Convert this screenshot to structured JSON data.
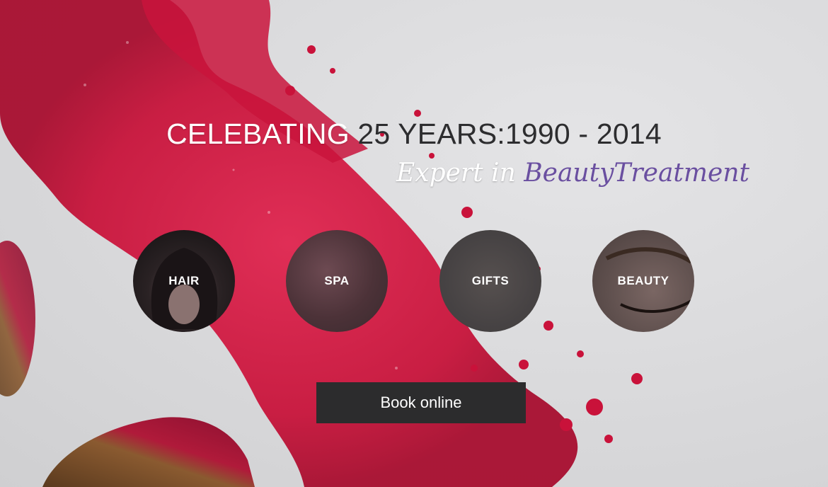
{
  "hero": {
    "headline_light": "CELEBATING",
    "headline_dark": "25 YEARS:1990 - 2014",
    "tagline_white": "Expert in",
    "tagline_purple": "BeautyTreatment"
  },
  "services": [
    {
      "label": "HAIR"
    },
    {
      "label": "SPA"
    },
    {
      "label": "GIFTS"
    },
    {
      "label": "BEAUTY"
    }
  ],
  "cta": {
    "label": "Book online"
  },
  "colors": {
    "accent_purple": "#6a4fa0",
    "powder_red": "#d0143e",
    "button_bg": "#2c2c2d",
    "background": "#dcdcde"
  }
}
